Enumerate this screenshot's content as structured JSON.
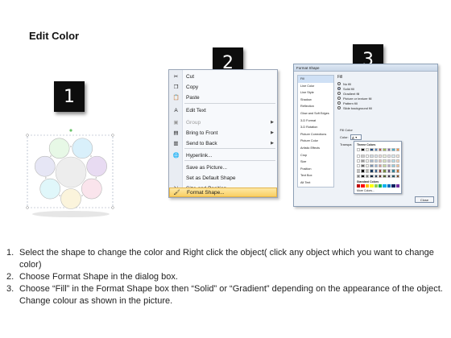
{
  "page": {
    "title": "Edit Color"
  },
  "badges": [
    "1",
    "2",
    "3"
  ],
  "context_menu": {
    "items": [
      {
        "label": "Cut",
        "icon": "scissors-icon",
        "glyph": "✂",
        "disabled": false
      },
      {
        "label": "Copy",
        "icon": "copy-icon",
        "glyph": "❐",
        "disabled": false
      },
      {
        "label": "Paste",
        "icon": "paste-icon",
        "glyph": "📋",
        "disabled": false
      },
      {
        "label": "Edit Text",
        "icon": "edit-text-icon",
        "glyph": "A",
        "disabled": false
      },
      {
        "label": "Group",
        "icon": "group-icon",
        "glyph": "▣",
        "disabled": true,
        "submenu": true
      },
      {
        "label": "Bring to Front",
        "icon": "bring-front-icon",
        "glyph": "▤",
        "disabled": false,
        "submenu": true
      },
      {
        "label": "Send to Back",
        "icon": "send-back-icon",
        "glyph": "▥",
        "disabled": false,
        "submenu": true
      },
      {
        "label": "Hyperlink...",
        "icon": "hyperlink-icon",
        "glyph": "🌐",
        "disabled": false
      },
      {
        "label": "Save as Picture...",
        "icon": "",
        "glyph": "",
        "disabled": false
      },
      {
        "label": "Set as Default Shape",
        "icon": "",
        "glyph": "",
        "disabled": false
      },
      {
        "label": "Size and Position...",
        "icon": "size-position-icon",
        "glyph": "⇲",
        "disabled": false
      },
      {
        "label": "Format Shape...",
        "icon": "format-shape-icon",
        "glyph": "🖌",
        "disabled": false,
        "highlighted": true
      }
    ]
  },
  "format_dialog": {
    "title": "Format Shape",
    "nav": [
      "Fill",
      "Line Color",
      "Line Style",
      "Shadow",
      "Reflection",
      "Glow and Soft Edges",
      "3-D Format",
      "3-D Rotation",
      "Picture Corrections",
      "Picture Color",
      "Artistic Effects",
      "Crop",
      "Size",
      "Position",
      "Text Box",
      "Alt Text"
    ],
    "fill_title": "Fill",
    "options": [
      "No fill",
      "Solid fill",
      "Gradient fill",
      "Picture or texture fill",
      "Pattern fill",
      "Slide background fill"
    ],
    "fill_color_label": "Fill Color",
    "color_label": "Color:",
    "transparency_label": "Transpa",
    "theme_colors_label": "Theme Colors",
    "standard_colors_label": "Standard Colors",
    "more_colors_label": "More Colors...",
    "close_label": "Close",
    "theme_colors": [
      "#ffffff",
      "#000000",
      "#eeece1",
      "#1f497d",
      "#4f81bd",
      "#c0504d",
      "#9bbb59",
      "#8064a2",
      "#4bacc6",
      "#f79646"
    ],
    "standard_colors": [
      "#c00000",
      "#ff0000",
      "#ffc000",
      "#ffff00",
      "#92d050",
      "#00b050",
      "#00b0f0",
      "#0070c0",
      "#002060",
      "#7030a0"
    ]
  },
  "diagram": {
    "circle_colors": [
      "#e7f8e6",
      "#d9f0fb",
      "#e8dbf2",
      "#fae4ec",
      "#fbf4dc",
      "#e0f7fa",
      "#e6e6f5"
    ],
    "center_color": "#ededed"
  },
  "instructions": [
    {
      "num": "1.",
      "text": "Select the shape to change the color and Right click the object( click any object which you want to change color)"
    },
    {
      "num": "2.",
      "text": "Choose Format Shape in the dialog box."
    },
    {
      "num": "3.",
      "text": "Choose “Fill” in the Format Shape box then “Solid” or “Gradient” depending on the appearance of the object. Change colour as shown in the picture."
    }
  ]
}
